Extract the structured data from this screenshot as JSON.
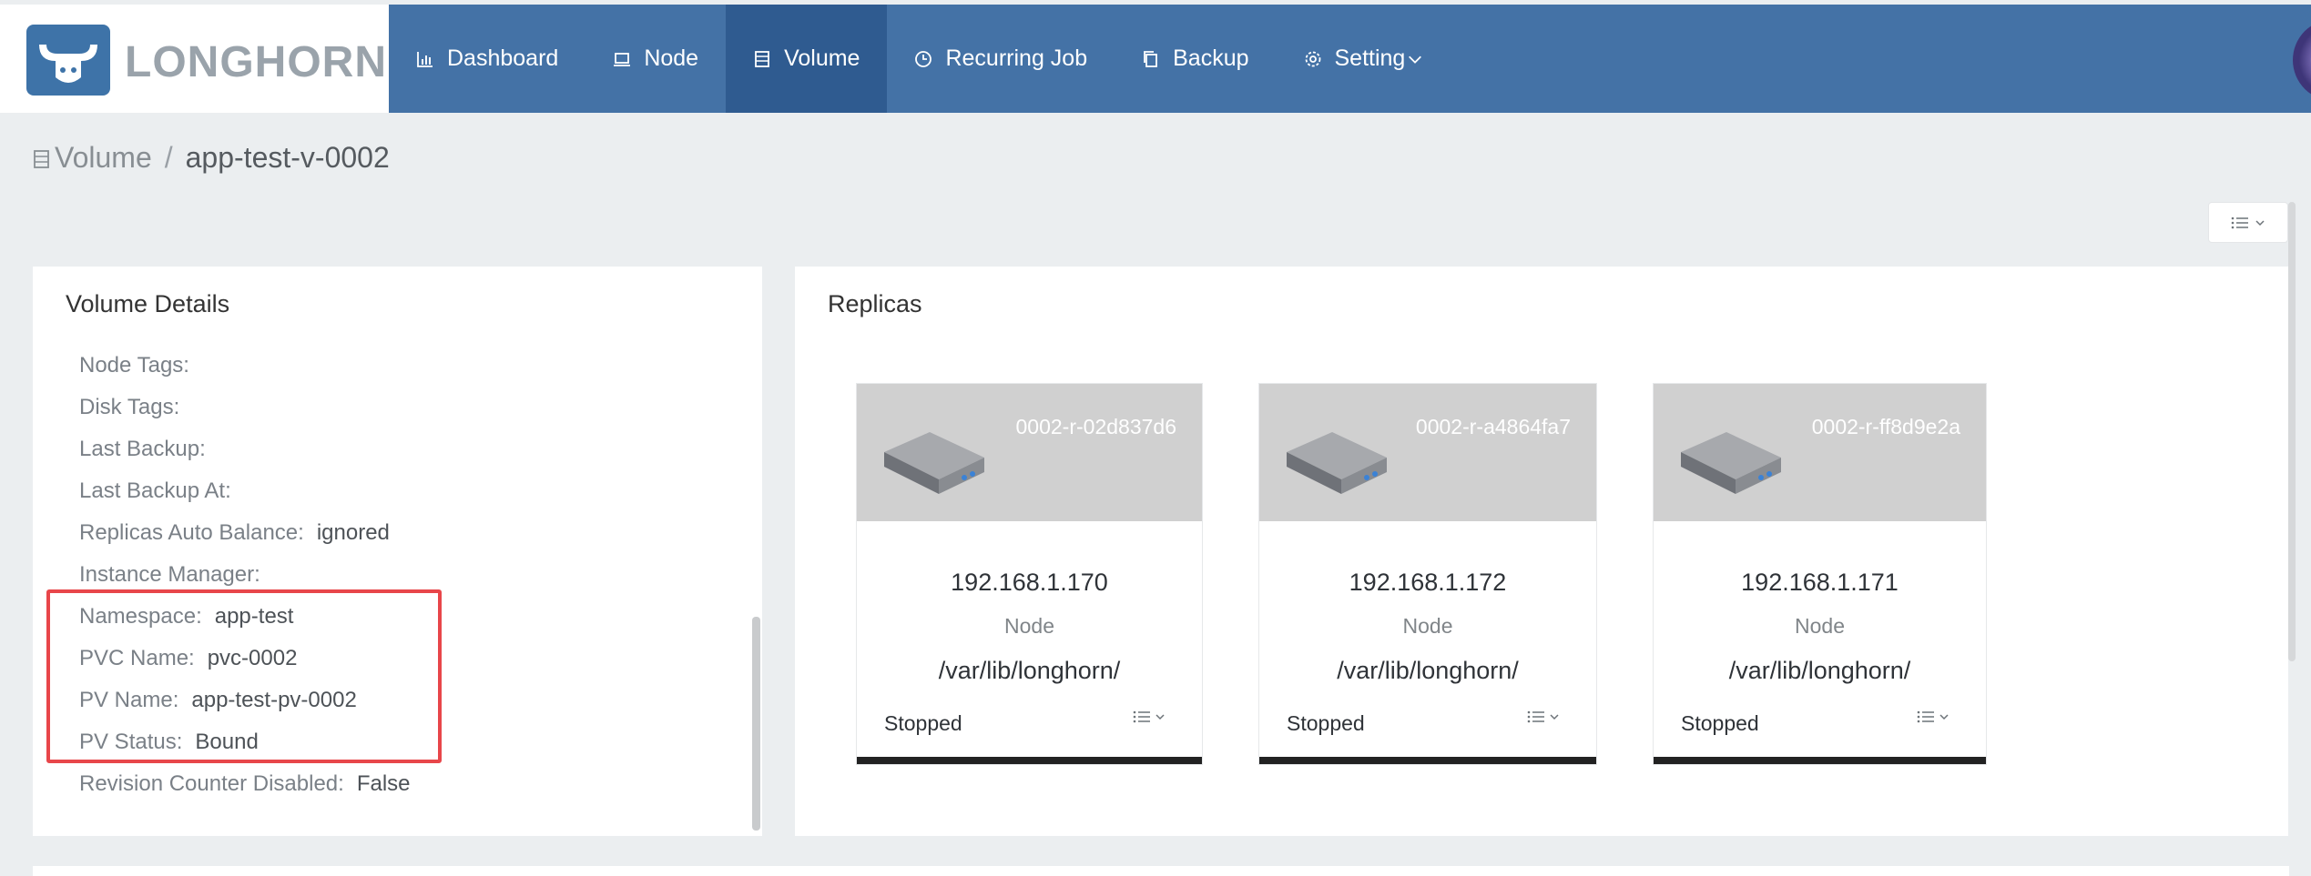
{
  "app": {
    "brand": "LONGHORN"
  },
  "nav": {
    "items": [
      {
        "label": "Dashboard",
        "icon": "bar-chart-icon",
        "active": false
      },
      {
        "label": "Node",
        "icon": "laptop-icon",
        "active": false
      },
      {
        "label": "Volume",
        "icon": "database-icon",
        "active": true
      },
      {
        "label": "Recurring Job",
        "icon": "clock-icon",
        "active": false
      },
      {
        "label": "Backup",
        "icon": "copy-icon",
        "active": false
      },
      {
        "label": "Setting",
        "icon": "gear-icon",
        "active": false
      }
    ]
  },
  "breadcrumb": {
    "root": "Volume",
    "separator": "/",
    "current": "app-test-v-0002"
  },
  "details": {
    "title": "Volume Details",
    "rows": [
      {
        "label": "Node Tags:",
        "value": ""
      },
      {
        "label": "Disk Tags:",
        "value": ""
      },
      {
        "label": "Last Backup:",
        "value": ""
      },
      {
        "label": "Last Backup At:",
        "value": ""
      },
      {
        "label": "Replicas Auto Balance:",
        "value": "ignored"
      },
      {
        "label": "Instance Manager:",
        "value": ""
      },
      {
        "label": "Namespace:",
        "value": "app-test"
      },
      {
        "label": "PVC Name:",
        "value": "pvc-0002"
      },
      {
        "label": "PV Name:",
        "value": "app-test-pv-0002"
      },
      {
        "label": "PV Status:",
        "value": "Bound"
      },
      {
        "label": "Revision Counter Disabled:",
        "value": "False"
      }
    ]
  },
  "replicas": {
    "title": "Replicas",
    "cards": [
      {
        "name": "0002-r-02d837d6",
        "ip": "192.168.1.170",
        "node_label": "Node",
        "path": "/var/lib/longhorn/",
        "status": "Stopped"
      },
      {
        "name": "0002-r-a4864fa7",
        "ip": "192.168.1.172",
        "node_label": "Node",
        "path": "/var/lib/longhorn/",
        "status": "Stopped"
      },
      {
        "name": "0002-r-ff8d9e2a",
        "ip": "192.168.1.171",
        "node_label": "Node",
        "path": "/var/lib/longhorn/",
        "status": "Stopped"
      }
    ]
  },
  "colors": {
    "header": "#4472a6",
    "active_nav": "#2f5b90",
    "highlight": "#e8464a"
  }
}
